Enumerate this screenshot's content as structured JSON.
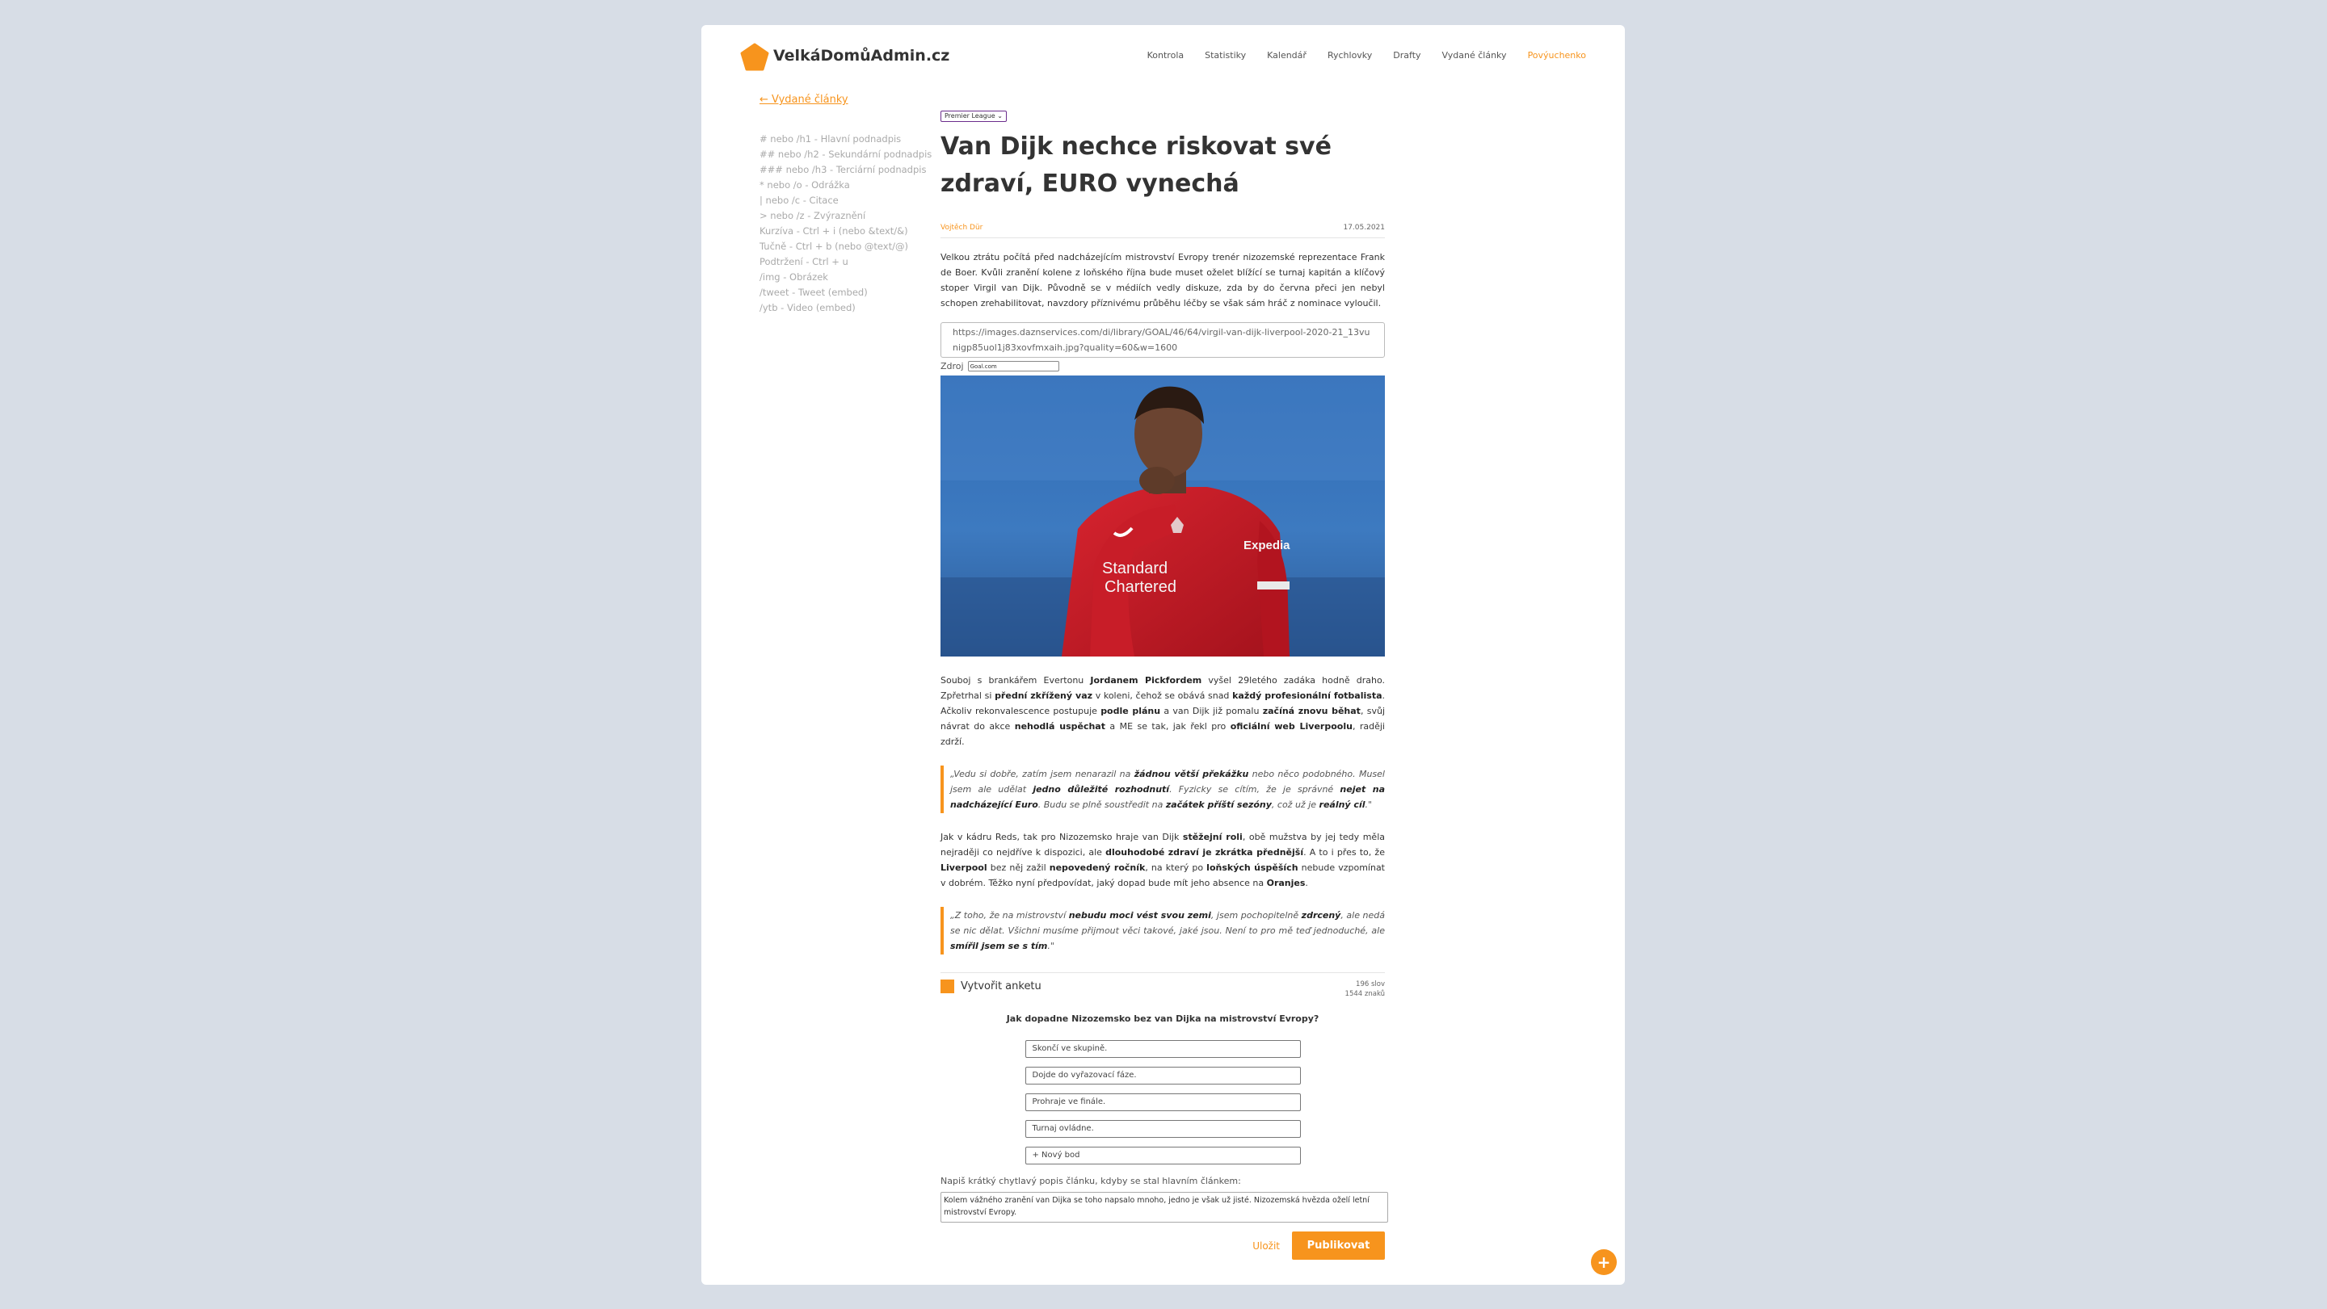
{
  "header": {
    "logo_text": "VelkáDomůAdmin.cz",
    "nav": [
      "Kontrola",
      "Statistiky",
      "Kalendář",
      "Rychlovky",
      "Drafty",
      "Vydané články",
      "Povýuchenko"
    ]
  },
  "sidebar": {
    "back_link": "← Vydané články",
    "hints": [
      "# nebo /h1 - Hlavní podnadpis",
      "## nebo /h2 - Sekundární podnadpis",
      "### nebo /h3 - Terciární podnadpis",
      "* nebo /o - Odrážka",
      "| nebo /c - Citace",
      "> nebo /z - Zvýraznění",
      "Kurzíva - Ctrl + i (nebo &text/&)",
      "Tučně - Ctrl + b (nebo @text/@)",
      "Podtržení - Ctrl + u",
      "/img - Obrázek",
      "/tweet - Tweet (embed)",
      "/ytb - Video (embed)"
    ]
  },
  "article": {
    "category": "Premier League",
    "title": "Van Dijk nechce riskovat své zdraví, EURO vynechá",
    "author": "Vojtěch Dür",
    "date": "17.05.2021",
    "perex": "Velkou ztrátu počítá před nadcházejícím mistrovství Evropy trenér nizozemské reprezentace Frank de Boer. Kvůli zranění kolene z loňského října bude muset oželet blížící se turnaj kapitán a klíčový stoper Virgil van Dijk. Původně se v médiích vedly diskuze, zda by do června přeci jen nebyl schopen zrehabilitovat, navzdory příznivému průběhu léčby se však sám hráč z nominace vyloučil.",
    "image_url": "https://images.daznservices.com/di/library/GOAL/46/64/virgil-van-dijk-liverpool-2020-21_13vunigp85uol1j83xovfmxaih.jpg?quality=60&w=1600",
    "source_label": "Zdroj",
    "source_value": "Goal.com",
    "p1": {
      "a": "Souboj s brankářem Evertonu ",
      "b1": "Jordanem Pickfordem",
      "c": " vyšel 29letého zadáka hodně draho. Zpřetrhal si ",
      "b2": "přední zkřížený vaz",
      "d": " v koleni, čehož se obává snad ",
      "b3": "každý profesionální fotbalista",
      "e": ". Ačkoliv rekonvalescence postupuje ",
      "b4": "podle plánu",
      "f": " a van Dijk již pomalu ",
      "b5": "začíná znovu běhat",
      "g": ", svůj návrat do akce ",
      "b6": "nehodlá uspěchat",
      "h": " a ME se tak, jak řekl pro ",
      "b7": "oficiální web Liverpoolu",
      "i": ", raději zdrží."
    },
    "q1": {
      "a": "„Vedu si dobře, zatím jsem nenarazil na ",
      "b1": "žádnou větší překážku",
      "c": " nebo něco podobného. Musel jsem ale udělat ",
      "b2": "jedno důležité rozhodnutí",
      "d": ". Fyzicky se cítím, že je správné ",
      "b3": "nejet na nadcházející Euro",
      "e": ". Budu se plně soustředit na ",
      "b4": "začátek příští sezóny",
      "f": ", což už je ",
      "b5": "reálný cíl",
      "g": ".\""
    },
    "p2": {
      "a": "Jak v kádru Reds, tak pro Nizozemsko hraje van Dijk ",
      "b1": "stěžejní roli",
      "c": ", obě mužstva by jej tedy měla nejraději co nejdříve k dispozici, ale ",
      "b2": "dlouhodobé zdraví je zkrátka přednější",
      "d": ". A to i přes to, že ",
      "b3": "Liverpool",
      "e": " bez něj zažil ",
      "b4": "nepovedený ročník",
      "f": ", na který po ",
      "b5": "loňských úspěších",
      "g": " nebude vzpomínat v dobrém. Těžko nyní předpovídat, jaký dopad bude mít jeho absence na ",
      "b6": "Oranjes",
      "h": "."
    },
    "q2": {
      "a": "„Z toho, že na mistrovství ",
      "b1": "nebudu moci vést svou zemi",
      "c": ", jsem pochopitelně ",
      "b2": "zdrcený",
      "d": ", ale nedá se nic dělat. Všichni musíme přijmout věci takové, jaké jsou. Není to pro mě teď jednoduché, ale ",
      "b3": "smířil jsem se s tím",
      "e": ".\""
    }
  },
  "poll": {
    "create_label": "Vytvořit anketu",
    "word_count": "196 slov",
    "char_count": "1544 znaků",
    "question": "Jak dopadne Nizozemsko bez van Dijka na mistrovství Evropy?",
    "options": [
      "Skončí ve skupině.",
      "Dojde do vyřazovací fáze.",
      "Prohraje ve finále.",
      "Turnaj ovládne.",
      "+ Nový bod"
    ]
  },
  "summary": {
    "label": "Napiš krátký chytlavý popis článku, kdyby se stal hlavním článkem:",
    "value": "Kolem vážného zranění van Dijka se toho napsalo mnoho, jedno je však už jisté. Nizozemská hvězda oželí letní mistrovství Evropy."
  },
  "actions": {
    "save": "Uložit",
    "publish": "Publikovat",
    "fab": "+"
  },
  "colors": {
    "accent": "#f7941d",
    "background": "#d7dde6",
    "category_border": "#6b2d8c"
  },
  "icons": {
    "logo": "pentagon-logo-icon",
    "category_dropdown": "chevron-down-icon",
    "poll": "poll-square-icon",
    "fab": "plus-icon"
  }
}
